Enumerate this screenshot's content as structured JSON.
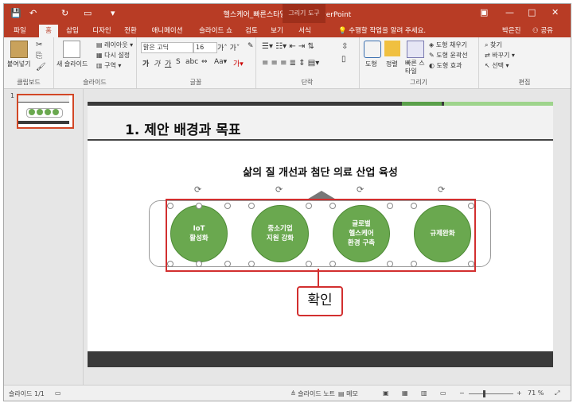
{
  "window": {
    "title": "헬스케어_빠른스타일.pptx - PowerPoint",
    "contextual_tab_group": "그리기 도구",
    "user_name": "박은진",
    "share_label": "공유"
  },
  "tabs": [
    "파일",
    "홈",
    "삽입",
    "디자인",
    "전환",
    "애니메이션",
    "슬라이드 쇼",
    "검토",
    "보기",
    "서식"
  ],
  "active_tab": "홈",
  "tell_me": "수행할 작업을 알려 주세요.",
  "ribbon": {
    "clipboard": {
      "paste": "붙여넣기",
      "label": "클립보드"
    },
    "slides": {
      "new_slide": "새 슬라이드",
      "layout": "레이아웃",
      "reset": "다시 설정",
      "section": "구역",
      "label": "슬라이드"
    },
    "font": {
      "name": "맑은 고딕",
      "size": "16",
      "label": "글꼴"
    },
    "paragraph": {
      "label": "단락"
    },
    "drawing": {
      "shape": "도형",
      "arrange": "정렬",
      "quick_style": "빠른 스타일",
      "fill": "도형 채우기",
      "outline": "도형 윤곽선",
      "effect": "도형 효과",
      "label": "그리기"
    },
    "editing": {
      "find": "찾기",
      "replace": "바꾸기",
      "select": "선택",
      "label": "편집"
    }
  },
  "thumbnail": {
    "number": "1"
  },
  "slide": {
    "title": "1. 제안 배경과 목표",
    "subtitle": "삶의 질 개선과 첨단 의료 산업 육성",
    "circles": [
      {
        "line1": "IoT",
        "line2": "활성화"
      },
      {
        "line1": "중소기업",
        "line2": "지원 강화"
      },
      {
        "line1": "글로벌",
        "line2": "헬스케어",
        "line3": "환경 구축"
      },
      {
        "line1": "규제완화",
        "line2": ""
      }
    ],
    "callout": "확인"
  },
  "colors": {
    "accent": "#b83c25",
    "circle": "#6aa84f",
    "highlight": "#d22f2f"
  },
  "status": {
    "slide_info": "슬라이드 1/1",
    "notes": "슬라이드 노트",
    "comments": "메모",
    "zoom": "71 %"
  }
}
